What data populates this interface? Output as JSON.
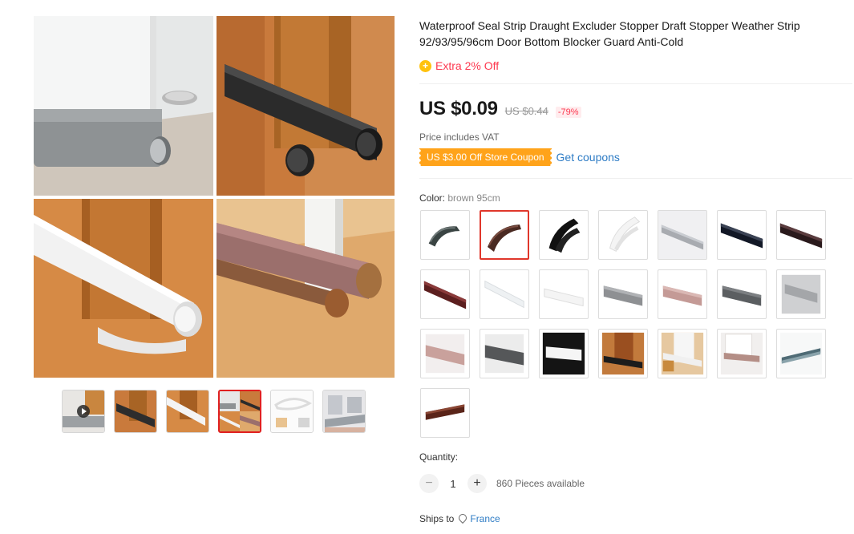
{
  "product": {
    "title": "Waterproof Seal Strip Draught Excluder Stopper Draft Stopper Weather Strip 92/93/95/96cm Door Bottom Blocker Guard Anti-Cold",
    "promo_icon": "plus-circle-icon",
    "promo_text": "Extra 2% Off",
    "price": "US $0.09",
    "original_price": "US $0.44",
    "discount": "-79%",
    "vat_note": "Price includes VAT",
    "coupon_label": "US $3.00 Off Store Coupon",
    "get_coupons": "Get coupons"
  },
  "colors": {
    "accent": "#e0372b",
    "promo": "#fd384f",
    "coupon": "#ffa31a",
    "link": "#2e7cc5"
  },
  "color_selector": {
    "label": "Color:",
    "selected": "brown 95cm",
    "selected_index": 1,
    "swatch_count": 22
  },
  "gallery": {
    "thumbnails": [
      {
        "name": "video-thumb",
        "has_play_icon": true
      },
      {
        "name": "black-strip-thumb"
      },
      {
        "name": "white-strip-thumb"
      },
      {
        "name": "collage-thumb",
        "active": true
      },
      {
        "name": "white-loop-thumb"
      },
      {
        "name": "gray-strip-thumb"
      }
    ]
  },
  "quantity": {
    "label": "Quantity:",
    "minus": "−",
    "value": "1",
    "plus": "+",
    "available": "860 Pieces available"
  },
  "shipping": {
    "label": "Ships to",
    "icon": "location-pin-icon",
    "destination": "France"
  }
}
